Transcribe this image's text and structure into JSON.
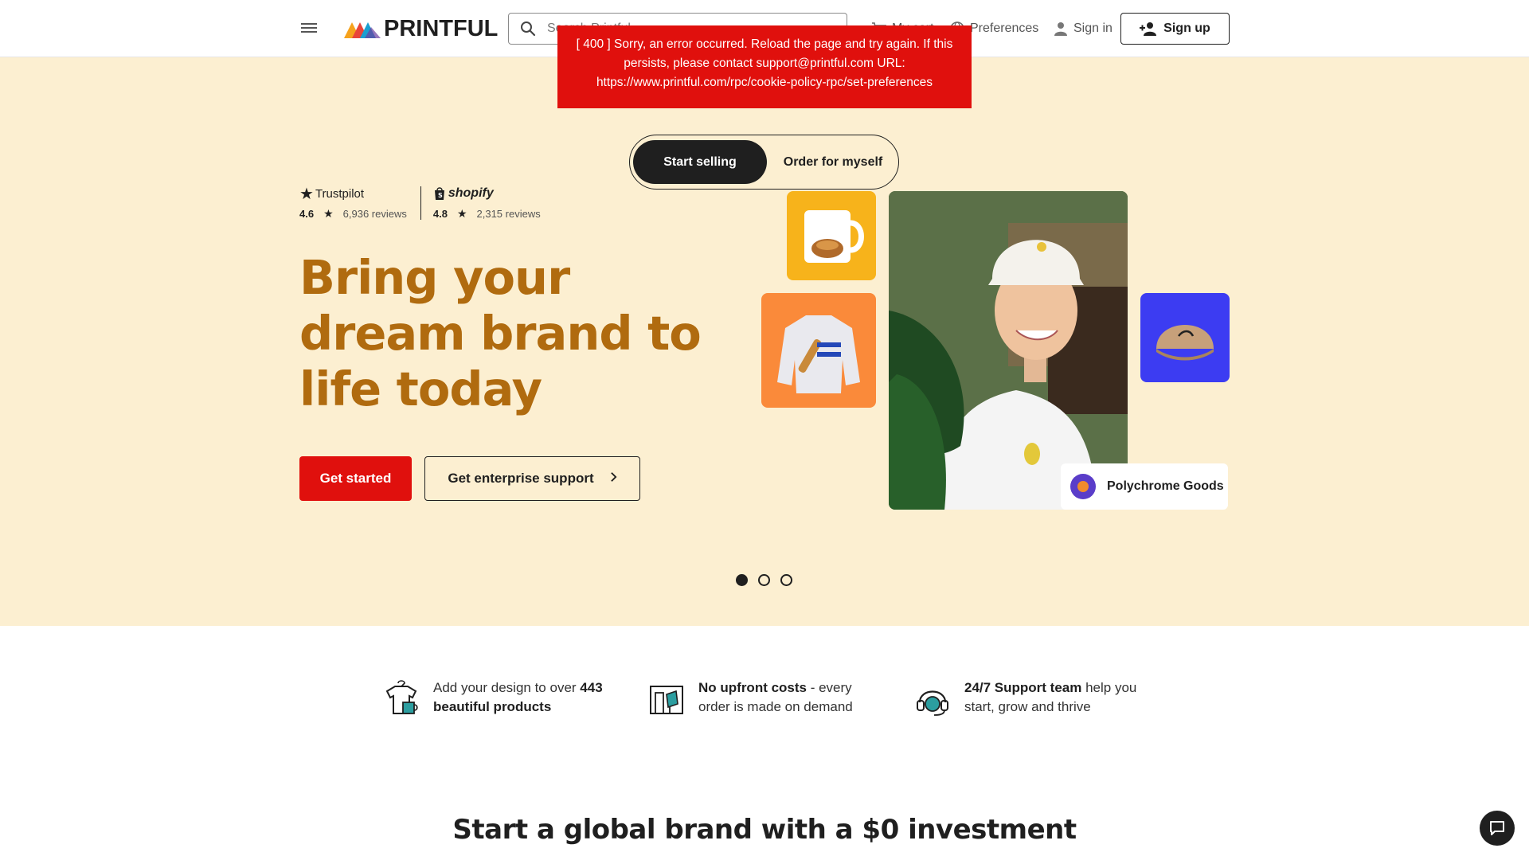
{
  "header": {
    "logo_text": "PRINTFUL",
    "search_placeholder": "Search Printful",
    "nav": {
      "my_cart": "My cart",
      "preferences": "Preferences",
      "sign_in": "Sign in",
      "sign_up": "Sign up"
    }
  },
  "toast": {
    "message": "[ 400 ] Sorry, an error occurred. Reload the page and try again. If this persists, please contact support@printful.com URL: https://www.printful.com/rpc/cookie-policy-rpc/set-preferences"
  },
  "toggle": {
    "option_active": "Start selling",
    "option_inactive": "Order for myself"
  },
  "ratings": [
    {
      "brand": "Trustpilot",
      "score": "4.6",
      "reviews": "6,936 reviews"
    },
    {
      "brand": "shopify",
      "score": "4.8",
      "reviews": "2,315 reviews"
    }
  ],
  "hero": {
    "headline": "Bring your dream brand to life today",
    "cta_primary": "Get started",
    "cta_secondary": "Get enterprise support",
    "brand_card": "Polychrome Goods",
    "carousel": {
      "total": 3,
      "active": 1
    }
  },
  "features": [
    {
      "pre": "Add your design to over ",
      "bold": "443 beautiful products",
      "post": ""
    },
    {
      "pre": "",
      "bold": "No upfront costs",
      "post": " - every order is made on demand"
    },
    {
      "pre": "",
      "bold": "24/7 Support team",
      "post": " help you start, grow and thrive"
    }
  ],
  "section_title": "Start a global brand with a $0 investment",
  "colors": {
    "hero_bg": "#fcefd1",
    "headline": "#b06b0f",
    "primary": "#e0100d",
    "toast": "#e0100d"
  },
  "icons": [
    "menu-icon",
    "search-icon",
    "cart-icon",
    "globe-icon",
    "user-icon",
    "add-user-icon",
    "chevron-right-icon",
    "chat-icon"
  ]
}
